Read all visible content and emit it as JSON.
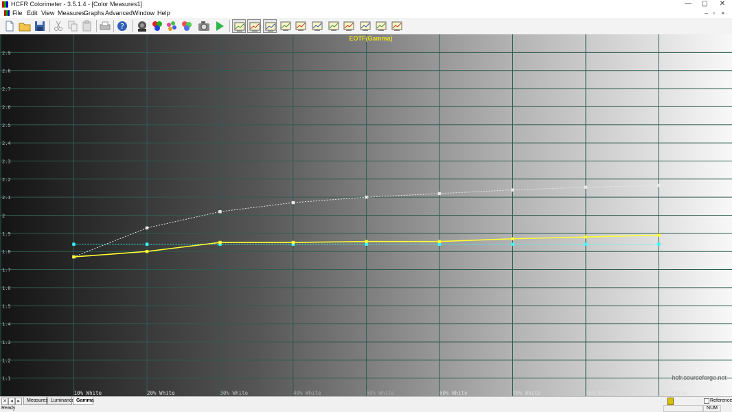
{
  "window": {
    "title": "HCFR Colorimeter - 3.5.1.4 - [Color Measures1]",
    "controls": [
      "—",
      "▢",
      "✕"
    ]
  },
  "menu": {
    "items": [
      "File",
      "Edit",
      "View",
      "Measures",
      "Graphs",
      "Advanced",
      "Window",
      "Help"
    ],
    "mdi_controls": [
      "–",
      "▫",
      "×"
    ]
  },
  "toolbar": {
    "icons": [
      "new-file-icon",
      "open-folder-icon",
      "save-icon",
      "cut-icon",
      "copy-icon",
      "paste-icon",
      "print-icon",
      "help-icon",
      "sensor-icon",
      "rgb-icon",
      "color-palette-icon",
      "gamut-icon",
      "camera-icon",
      "play-icon",
      "chart-view-icon",
      "chart-view-icon",
      "chart-view-icon",
      "chart-view-icon",
      "chart-view-icon",
      "chart-view-icon",
      "chart-view-icon",
      "chart-view-icon",
      "chart-view-icon",
      "chart-view-icon",
      "chart-view-icon"
    ]
  },
  "chart_data": {
    "type": "line",
    "title": "EOTF(Gamma)",
    "categories": [
      "10% White",
      "20% White",
      "30% White",
      "40% White",
      "50% White",
      "60% White",
      "70% White",
      "80% White",
      "90% White"
    ],
    "ylim": [
      1.0,
      3.0
    ],
    "yticks": [
      "1.1",
      "1.2",
      "1.3",
      "1.4",
      "1.5",
      "1.6",
      "1.7",
      "1.8",
      "1.9",
      "2",
      "2.1",
      "2.2",
      "2.3",
      "2.4",
      "2.5",
      "2.6",
      "2.7",
      "2.8",
      "2.9"
    ],
    "grid": true,
    "background": "grayscale ramp, dark to light",
    "watermark": "hcfr.sourceforge.net",
    "series": [
      {
        "color": "#ffff33",
        "style": "solid",
        "values": [
          1.77,
          1.8,
          1.85,
          1.85,
          1.855,
          1.855,
          1.87,
          1.88,
          1.89
        ]
      },
      {
        "color": "#e8e8e8",
        "style": "dotted",
        "values": [
          1.77,
          1.93,
          2.02,
          2.07,
          2.1,
          2.12,
          2.14,
          2.155,
          2.165
        ]
      },
      {
        "color": "#33ffff",
        "style": "dotted",
        "values": [
          1.84,
          1.84,
          1.84,
          1.84,
          1.84,
          1.84,
          1.84,
          1.84,
          1.84
        ]
      }
    ]
  },
  "tabs": {
    "nav": [
      "✕",
      "◂",
      "▸"
    ],
    "items": [
      "Measures",
      "Luminance",
      "Gamma"
    ],
    "active": 2,
    "reference_label": "Reference"
  },
  "status": {
    "text": "Ready",
    "num": "NUM"
  }
}
